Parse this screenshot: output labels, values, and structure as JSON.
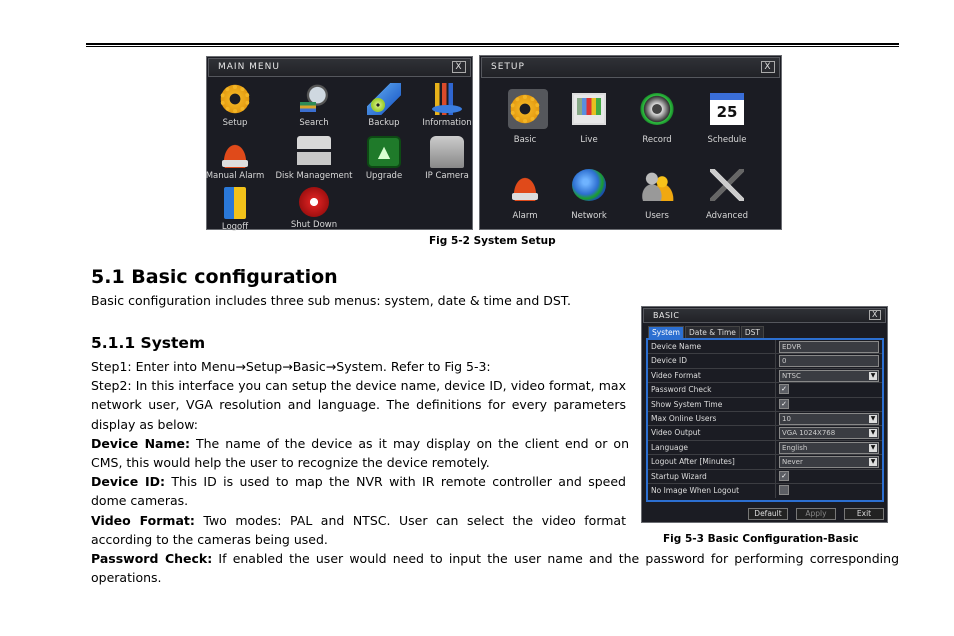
{
  "main_menu": {
    "title": "MAIN MENU",
    "close": "X",
    "items": [
      {
        "label": "Setup",
        "icon": "gear-icon"
      },
      {
        "label": "Search",
        "icon": "search-icon"
      },
      {
        "label": "Backup",
        "icon": "backup-icon"
      },
      {
        "label": "Information",
        "icon": "information-icon"
      },
      {
        "label": "Manual Alarm",
        "icon": "alarm-icon"
      },
      {
        "label": "Disk Management",
        "icon": "disk-icon"
      },
      {
        "label": "Upgrade",
        "icon": "upgrade-icon"
      },
      {
        "label": "IP Camera",
        "icon": "ip-camera-icon"
      },
      {
        "label": "Logoff",
        "icon": "logoff-icon"
      },
      {
        "label": "Shut Down",
        "icon": "power-icon"
      }
    ]
  },
  "setup_menu": {
    "title": "SETUP",
    "close": "X",
    "selected": "Basic",
    "calendar_text": "25",
    "items": [
      {
        "label": "Basic",
        "icon": "gear-icon"
      },
      {
        "label": "Live",
        "icon": "monitor-icon"
      },
      {
        "label": "Record",
        "icon": "film-reel-icon"
      },
      {
        "label": "Schedule",
        "icon": "calendar-icon"
      },
      {
        "label": "Alarm",
        "icon": "alarm-icon"
      },
      {
        "label": "Network",
        "icon": "globe-icon"
      },
      {
        "label": "Users",
        "icon": "users-icon"
      },
      {
        "label": "Advanced",
        "icon": "tools-icon"
      }
    ]
  },
  "fig_5_2_caption": "Fig 5-2 System Setup",
  "section": {
    "heading": "5.1  Basic configuration",
    "intro": "Basic configuration includes three sub menus: system, date & time and DST."
  },
  "subsection": {
    "heading": "5.1.1  System",
    "step1": "Step1: Enter into Menu→Setup→Basic→System. Refer to Fig 5-3:",
    "step2": "Step2: In this interface you can setup the device name, device ID, video format, max network user, VGA resolution and language. The definitions for every parameters display as below:",
    "definitions": [
      {
        "term": "Device Name:",
        "text": " The name of the device as it may display on the client end or on CMS, this would help the user to recognize the device remotely."
      },
      {
        "term": "Device ID:",
        "text": " This ID is used to map the NVR with IR remote controller and speed dome cameras."
      },
      {
        "term": "Video Format:",
        "text": " Two modes: PAL and NTSC. User can select the video format according to the cameras being used."
      },
      {
        "term": "Password Check:",
        "text": " If enabled the user would need to input the user name and the password for performing corresponding operations."
      }
    ]
  },
  "basic_dialog": {
    "title": "BASIC",
    "close": "X",
    "tabs": [
      "System",
      "Date & Time",
      "DST"
    ],
    "active_tab": "System",
    "fields": [
      {
        "label": "Device Name",
        "type": "text",
        "value": "EDVR"
      },
      {
        "label": "Device ID",
        "type": "text",
        "value": "0"
      },
      {
        "label": "Video Format",
        "type": "select",
        "value": "NTSC"
      },
      {
        "label": "Password Check",
        "type": "checkbox",
        "checked": true
      },
      {
        "label": "Show System Time",
        "type": "checkbox",
        "checked": true
      },
      {
        "label": "Max Online Users",
        "type": "select",
        "value": "10"
      },
      {
        "label": "Video Output",
        "type": "select",
        "value": "VGA 1024X768"
      },
      {
        "label": "Language",
        "type": "select",
        "value": "English"
      },
      {
        "label": "Logout After [Minutes]",
        "type": "select",
        "value": "Never"
      },
      {
        "label": "Startup Wizard",
        "type": "checkbox",
        "checked": true
      },
      {
        "label": "No Image When Logout",
        "type": "checkbox",
        "checked": false
      }
    ],
    "buttons": {
      "default": "Default",
      "apply": "Apply",
      "exit": "Exit"
    }
  },
  "fig_5_3_caption": "Fig 5-3 Basic Configuration-Basic"
}
